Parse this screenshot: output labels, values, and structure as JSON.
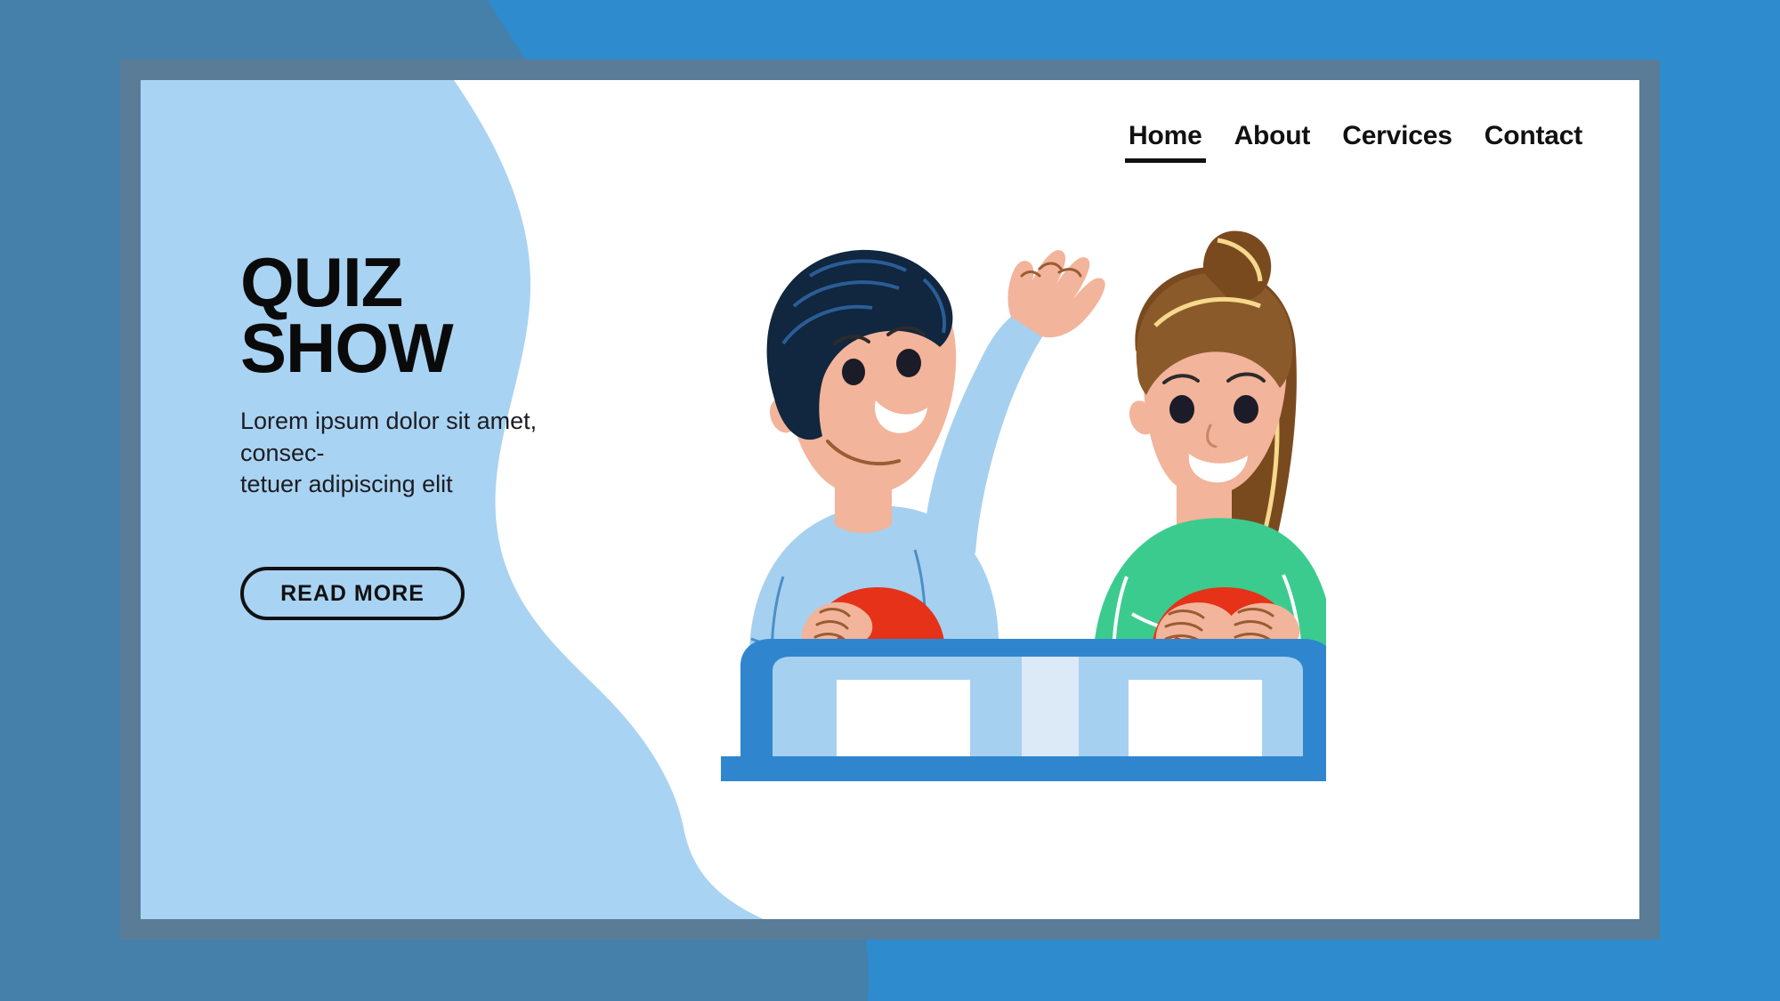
{
  "theme": {
    "background_blue": "#4580ab",
    "accent_blue": "#2e8bce",
    "frame_border": "#5a7c97",
    "card_background": "#ffffff",
    "wave_light_blue": "#a9d3f2",
    "text_dark": "#0a0a0a",
    "buzzer_red": "#e53218",
    "shirt_blue": "#a6d0f0",
    "sweater_green": "#3ccb8f",
    "hair_dark": "#11263f",
    "hair_brown": "#8b5a2b",
    "skin": "#f2b49a",
    "podium_blue": "#2f86cf",
    "podium_panel": "#a6d0f0"
  },
  "nav": {
    "items": [
      {
        "label": "Home",
        "active": true
      },
      {
        "label": "About",
        "active": false
      },
      {
        "label": "Cervices",
        "active": false
      },
      {
        "label": "Contact",
        "active": false
      }
    ]
  },
  "hero": {
    "title": "QUIZ\nSHOW",
    "subtitle": "Lorem ipsum dolor sit amet, consec-\ntetuer adipiscing elit",
    "cta_label": "READ MORE"
  },
  "illustration": {
    "name": "quiz-show-contestants",
    "description": "Two children at a quiz show podium with red buzzer buttons",
    "characters": [
      {
        "name": "boy",
        "hair": "dark-navy",
        "shirt": "light-blue",
        "pose": "hand-raised",
        "buzzer": "red"
      },
      {
        "name": "girl",
        "hair": "brown-ponytail",
        "shirt": "green",
        "pose": "hands-on-buzzer",
        "buzzer": "red"
      }
    ],
    "podium": {
      "panels": 2,
      "score_cards": 2
    }
  }
}
